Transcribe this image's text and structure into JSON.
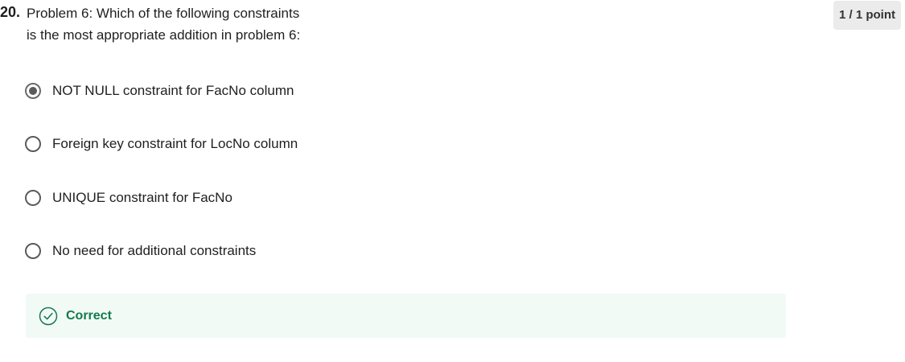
{
  "question": {
    "number": "20.",
    "line1": "Problem 6: Which of the following constraints",
    "line2": "is the most appropriate addition in problem 6:",
    "points": "1 / 1 point"
  },
  "options": [
    {
      "label": "NOT NULL constraint for FacNo column",
      "selected": true
    },
    {
      "label": "Foreign key constraint for LocNo column",
      "selected": false
    },
    {
      "label": "UNIQUE constraint for FacNo",
      "selected": false
    },
    {
      "label": "No need for additional constraints",
      "selected": false
    }
  ],
  "feedback": {
    "label": "Correct",
    "icon": "check-circle-icon",
    "color": "#137a4b",
    "background": "#f2faf6"
  }
}
